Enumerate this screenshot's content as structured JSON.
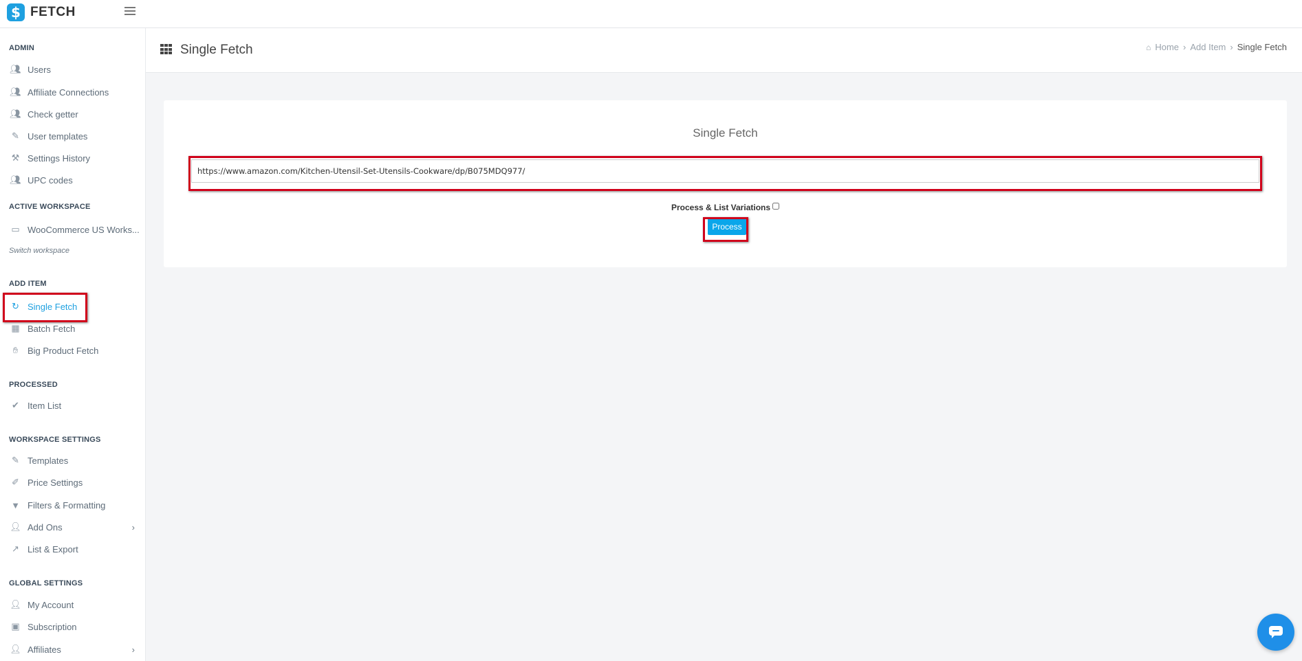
{
  "app": {
    "logo_mark": "$",
    "name": "FETCH"
  },
  "sidebar": {
    "sections": {
      "admin": "ADMIN",
      "active_workspace": "ACTIVE WORKSPACE",
      "add_item": "ADD ITEM",
      "processed": "PROCESSED",
      "workspace_settings": "WORKSPACE SETTINGS",
      "global_settings": "GLOBAL SETTINGS"
    },
    "items": {
      "users": "Users",
      "affiliate_connections": "Affiliate Connections",
      "check_getter": "Check getter",
      "user_templates": "User templates",
      "settings_history": "Settings History",
      "upc_codes": "UPC codes",
      "workspace": "WooCommerce US Works...",
      "switch_workspace": "Switch workspace",
      "single_fetch": "Single Fetch",
      "batch_fetch": "Batch Fetch",
      "big_product_fetch": "Big Product Fetch",
      "item_list": "Item List",
      "templates": "Templates",
      "price_settings": "Price Settings",
      "filters_formatting": "Filters & Formatting",
      "add_ons": "Add Ons",
      "list_export": "List & Export",
      "my_account": "My Account",
      "subscription": "Subscription",
      "affiliates": "Affiliates"
    },
    "active_item": "Single Fetch"
  },
  "header": {
    "title": "Single Fetch",
    "breadcrumb": [
      "Home",
      "Add Item",
      "Single Fetch"
    ]
  },
  "main": {
    "card_title": "Single Fetch",
    "url_value": "https://www.amazon.com/Kitchen-Utensil-Set-Utensils-Cookware/dp/B075MDQ977/",
    "variations_label": "Process & List Variations",
    "variations_checked": false,
    "process_label": "Process"
  },
  "colors": {
    "accent": "#1ea0e0",
    "button": "#0aa6ea",
    "highlight": "#d0021b",
    "chat": "#1f8fe8"
  },
  "icons": {
    "menu": "hamburger-icon",
    "page": "grid-icon",
    "home": "home-icon",
    "chat": "chat-icon"
  }
}
